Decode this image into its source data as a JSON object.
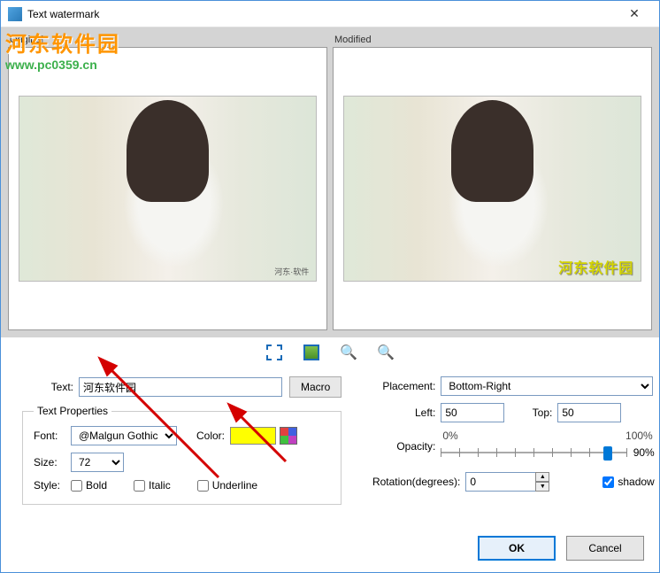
{
  "window": {
    "title": "Text watermark"
  },
  "overlay": {
    "cn": "河东软件园",
    "url": "www.pc0359.cn"
  },
  "preview": {
    "original_label": "Original",
    "modified_label": "Modified",
    "orig_wm": "河东·软件",
    "mod_wm": "河东软件园"
  },
  "icons": {
    "fit": "fit",
    "fill": "fill",
    "zoom_in": "+",
    "zoom_out": "−"
  },
  "form": {
    "text_label": "Text:",
    "text_value": "河东软件园",
    "macro_label": "Macro",
    "fieldset_legend": "Text Properties",
    "font_label": "Font:",
    "font_value": "@Malgun Gothic",
    "color_label": "Color:",
    "color_value": "#ffff00",
    "size_label": "Size:",
    "size_value": "72",
    "style_label": "Style:",
    "bold_label": "Bold",
    "italic_label": "Italic",
    "underline_label": "Underline",
    "placement_label": "Placement:",
    "placement_value": "Bottom-Right",
    "left_label": "Left:",
    "left_value": "50",
    "top_label": "Top:",
    "top_value": "50",
    "opacity_label": "Opacity:",
    "opacity_min": "0%",
    "opacity_max": "100%",
    "opacity_value": "90%",
    "rotation_label": "Rotation(degrees):",
    "rotation_value": "0",
    "shadow_label": "shadow"
  },
  "buttons": {
    "ok": "OK",
    "cancel": "Cancel"
  }
}
